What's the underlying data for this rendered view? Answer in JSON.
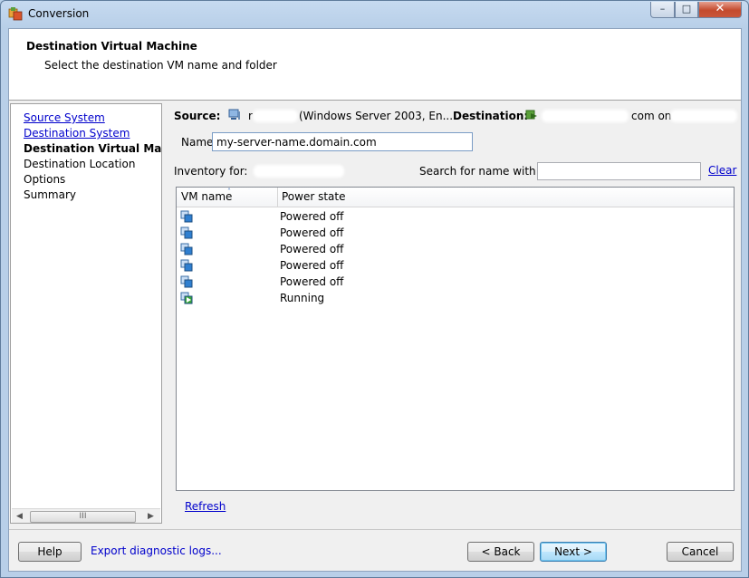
{
  "window": {
    "title": "Conversion",
    "controls": {
      "minimize": "–",
      "maximize": "□",
      "close": "✕"
    }
  },
  "header": {
    "title": "Destination Virtual Machine",
    "subtitle": "Select the destination VM name and folder"
  },
  "nav": {
    "items": [
      {
        "label": "Source System",
        "state": "link"
      },
      {
        "label": "Destination System",
        "state": "link"
      },
      {
        "label": "Destination Virtual Machi",
        "state": "current"
      },
      {
        "label": "Destination Location",
        "state": "plain"
      },
      {
        "label": "Options",
        "state": "plain"
      },
      {
        "label": "Summary",
        "state": "plain"
      }
    ],
    "scroll_thumb_grip": "III"
  },
  "source": {
    "label": "Source:",
    "host_prefix": "r",
    "os": "(Windows Server 2003, En...",
    "icon": "computer-icon"
  },
  "destination": {
    "label": "Destination:",
    "host_suffix": "com on",
    "icon": "vcenter-icon"
  },
  "name_field": {
    "label": "Name:",
    "value": "my-server-name.domain.com"
  },
  "inventory": {
    "label": "Inventory for:"
  },
  "search": {
    "label": "Search for name with:",
    "value": "",
    "clear_label": "Clear"
  },
  "table": {
    "columns": [
      "VM name",
      "Power state"
    ],
    "sort_indicator": "˄",
    "rows": [
      {
        "power_state": "Powered off",
        "icon": "vm-powered-off-icon",
        "status_color": "#2f7fd0"
      },
      {
        "power_state": "Powered off",
        "icon": "vm-powered-off-icon",
        "status_color": "#2f7fd0"
      },
      {
        "power_state": "Powered off",
        "icon": "vm-powered-off-icon",
        "status_color": "#2f7fd0"
      },
      {
        "power_state": "Powered off",
        "icon": "vm-powered-off-icon",
        "status_color": "#2f7fd0"
      },
      {
        "power_state": "Powered off",
        "icon": "vm-powered-off-icon",
        "status_color": "#2f7fd0"
      },
      {
        "power_state": "Running",
        "icon": "vm-running-icon",
        "status_color": "#3aa63a"
      }
    ]
  },
  "refresh_label": "Refresh",
  "footer": {
    "help_label": "Help",
    "export_label": "Export diagnostic logs...",
    "back_label": "< Back",
    "next_label": "Next >",
    "cancel_label": "Cancel"
  }
}
